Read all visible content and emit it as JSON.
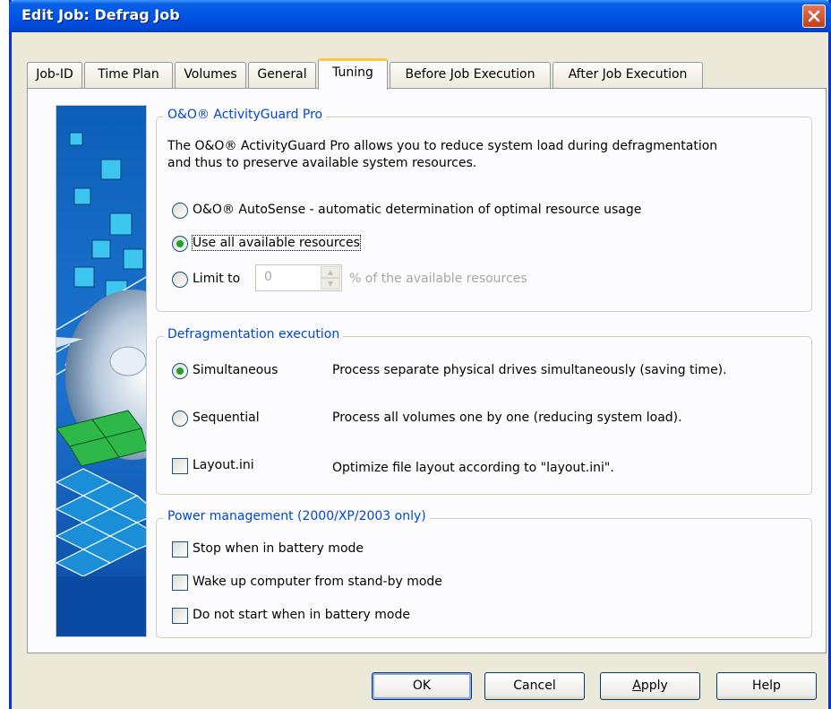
{
  "window": {
    "title": "Edit Job: Defrag Job",
    "close_icon": "close-x-icon"
  },
  "tabs": [
    {
      "label": "Job-ID"
    },
    {
      "label": "Time Plan"
    },
    {
      "label": "Volumes"
    },
    {
      "label": "General"
    },
    {
      "label": "Tuning",
      "active": true
    },
    {
      "label": "Before Job Execution"
    },
    {
      "label": "After Job Execution"
    }
  ],
  "activity_guard": {
    "legend": "O&O® ActivityGuard Pro",
    "description_line1": "The O&O® ActivityGuard Pro allows you to reduce system load during defragmentation",
    "description_line2": "and thus to preserve available system resources.",
    "autosense_label": "O&O® AutoSense - automatic determination of optimal resource usage",
    "use_all_label": "Use all available resources",
    "limit_label": "Limit to",
    "limit_value": "0",
    "limit_suffix": "% of the available resources",
    "selected": "use_all"
  },
  "execution": {
    "legend": "Defragmentation execution",
    "simultaneous_label": "Simultaneous",
    "simultaneous_desc": "Process separate physical drives simultaneously (saving time).",
    "sequential_label": "Sequential",
    "sequential_desc": "Process all volumes one by one (reducing system load).",
    "layout_label": "Layout.ini",
    "layout_desc": "Optimize file layout according to \"layout.ini\".",
    "selected": "simultaneous",
    "layout_checked": false
  },
  "power": {
    "legend": "Power management (2000/XP/2003 only)",
    "stop_battery": "Stop when in battery mode",
    "wake_up": "Wake up computer from stand-by mode",
    "no_start_battery": "Do not start when in battery mode"
  },
  "buttons": {
    "ok": "OK",
    "cancel": "Cancel",
    "apply_first": "A",
    "apply_rest": "pply",
    "help": "Help"
  },
  "colors": {
    "titlebar": "#0055e5",
    "legend_text": "#0046d5",
    "active_tab_highlight": "#ffc73c",
    "radio_dot": "#21a121"
  }
}
